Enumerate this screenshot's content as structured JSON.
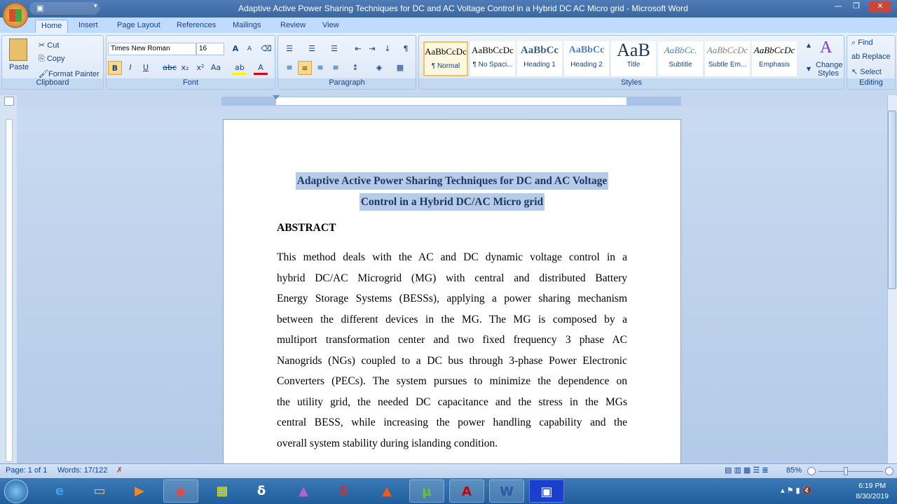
{
  "window": {
    "title": "Adaptive Active Power Sharing Techniques for DC and AC Voltage Control in a Hybrid DC AC Micro grid - Microsoft Word"
  },
  "tabs": [
    "Home",
    "Insert",
    "Page Layout",
    "References",
    "Mailings",
    "Review",
    "View"
  ],
  "clipboard": {
    "paste": "Paste",
    "cut": "Cut",
    "copy": "Copy",
    "format_painter": "Format Painter",
    "label": "Clipboard"
  },
  "font": {
    "name": "Times New Roman",
    "size": "16",
    "label": "Font"
  },
  "paragraph": {
    "label": "Paragraph"
  },
  "styles": {
    "items": [
      {
        "preview": "AaBbCcDc",
        "name": "¶ Normal"
      },
      {
        "preview": "AaBbCcDc",
        "name": "¶ No Spaci..."
      },
      {
        "preview": "AaBbCc",
        "name": "Heading 1"
      },
      {
        "preview": "AaBbCc",
        "name": "Heading 2"
      },
      {
        "preview": "AaB",
        "name": "Title"
      },
      {
        "preview": "AaBbCc.",
        "name": "Subtitle"
      },
      {
        "preview": "AaBbCcDc",
        "name": "Subtle Em..."
      },
      {
        "preview": "AaBbCcDc",
        "name": "Emphasis"
      }
    ],
    "change_styles": "Change Styles",
    "label": "Styles"
  },
  "editing": {
    "find": "Find",
    "replace": "Replace",
    "select": "Select",
    "label": "Editing"
  },
  "document": {
    "title_lines": [
      "Adaptive Active Power Sharing Techniques for DC and AC Voltage",
      "Control in a Hybrid DC/AC Micro grid"
    ],
    "heading": "ABSTRACT",
    "body_lines": [
      "This method deals with the AC and DC dynamic voltage control in a",
      "hybrid DC/AC Microgrid (MG) with central and distributed Battery",
      "Energy Storage Systems (BESSs), applying a power sharing mechanism",
      "between the different devices in the MG. The MG is composed by a",
      "multiport transformation center and two fixed frequency 3 phase AC",
      "Nanogrids (NGs) coupled to a DC bus through 3-phase Power Electronic",
      "Converters (PECs). The system pursues to minimize the dependence on",
      "the utility grid, the needed DC capacitance and the stress in the MGs",
      "central BESS, while increasing the power handling capability and the",
      "overall system stability during islanding condition."
    ]
  },
  "status": {
    "page": "Page: 1 of 1",
    "words": "Words: 17/122",
    "zoom": "85%"
  },
  "taskbar": {
    "time": "6:19 PM",
    "date": "8/30/2019"
  }
}
